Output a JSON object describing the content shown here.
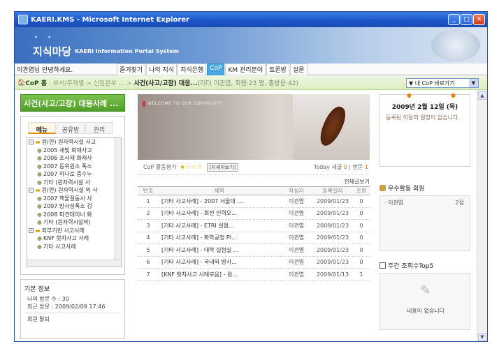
{
  "window": {
    "title": "KAERI.KMS - Microsoft Internet Explorer"
  },
  "banner": {
    "logo": "지식마당",
    "subtitle": "KAERI Information Portal System"
  },
  "menubar": {
    "greeting": "이관엽님 안녕하세요.",
    "nav": [
      "즐겨찾기",
      "나의 지식",
      "지식은행",
      "CoP",
      "KM 관리분야",
      "토론방",
      "설문"
    ]
  },
  "breadcrumb": {
    "home": "CoP 홈",
    "path": ": 부서/주제별 > 신임본부 ... >",
    "current": "사건(사고/고장) 대응...",
    "meta": "(리더 이관엽, 회원:23 명, 총방문:42)",
    "quick_label": "▼ 내 CoP 바로가기"
  },
  "left": {
    "cop_title": "사건(사고/고장) 대응사례 ...",
    "tabs": [
      "메뉴",
      "공유방",
      "관리"
    ],
    "tree": [
      {
        "level": 1,
        "kind": "folder",
        "label": "원(연) 원자력시설 사고"
      },
      {
        "level": 2,
        "kind": "leaf",
        "label": "2005 새빛 화재사고"
      },
      {
        "level": 2,
        "kind": "leaf",
        "label": "2006 조사재 화재사"
      },
      {
        "level": 2,
        "kind": "leaf",
        "label": "2007 동위원소 폭소"
      },
      {
        "level": 2,
        "kind": "leaf",
        "label": "2007 하나로 중수누"
      },
      {
        "level": 2,
        "kind": "leaf",
        "label": "기타 (원자력시설 사"
      },
      {
        "level": 1,
        "kind": "folder",
        "label": "원(연) 원자력시설 외 사"
      },
      {
        "level": 2,
        "kind": "leaf",
        "label": "2007 핵물질동시 사"
      },
      {
        "level": 2,
        "kind": "leaf",
        "label": "2007 방사성폭소 검"
      },
      {
        "level": 2,
        "kind": "leaf",
        "label": "2008 파견테이너 화"
      },
      {
        "level": 2,
        "kind": "leaf",
        "label": "기타 (원자력시설외)"
      },
      {
        "level": 1,
        "kind": "folder",
        "label": "외부기관 사고사례"
      },
      {
        "level": 2,
        "kind": "leaf",
        "label": "KNF 핫차사고 사례"
      },
      {
        "level": 2,
        "kind": "leaf",
        "label": "기타 사고사례"
      }
    ],
    "info": {
      "heading": "기본 정보",
      "visits": "나의 방문 수 : 30",
      "last_visit": "최근 방문 : 2009/02/09 17:46",
      "withdraw": "회원 탈퇴"
    }
  },
  "main": {
    "hero_caption": "WELCOME TO OUR COMMUNITY",
    "activity_label": "CoP 활동평가",
    "stars": "★☆☆☆",
    "rate_button": "[지세히보기]",
    "today_label": "Today 새글",
    "today_count": "0",
    "visit_label": "방문",
    "visit_count": "1",
    "more": "전체글보기",
    "columns": [
      "번호",
      "제목",
      "작성자",
      "등록일자",
      "조회"
    ],
    "rows": [
      [
        "1",
        "[기타 사고사례] - 2007 서울대 ...",
        "이관엽",
        "2009/01/23",
        "0"
      ],
      [
        "2",
        "[기타 사고사례] - 회전 인력오...",
        "이관엽",
        "2009/01/23",
        "0"
      ],
      [
        "3",
        "[기타 사고사례] - ETRI 실험...",
        "이관엽",
        "2009/01/23",
        "0"
      ],
      [
        "4",
        "[기타 사고사례] - 화학공정 Pl...",
        "이관엽",
        "2009/01/23",
        "0"
      ],
      [
        "5",
        "[기타 사고사례] - 대학 실험실 ...",
        "이관엽",
        "2009/01/23",
        "0"
      ],
      [
        "6",
        "[기타 사고사례] - 국내외 방사...",
        "이관엽",
        "2009/01/23",
        "0"
      ],
      [
        "7",
        "[KNF 핫차사고 사례모음] - 원...",
        "이관엽",
        "2009/01/13",
        "1"
      ]
    ]
  },
  "right": {
    "calendar_date": "2009년 2월 12일 (목)",
    "calendar_msg": "등록된 이달의 일정이 없습니다.",
    "members_title": "우수활동 회원",
    "member_name": "· 이관엽",
    "member_count": "2점",
    "top5_title": "주간 조회수Top5",
    "top5_empty": "내용이 없습니다"
  }
}
